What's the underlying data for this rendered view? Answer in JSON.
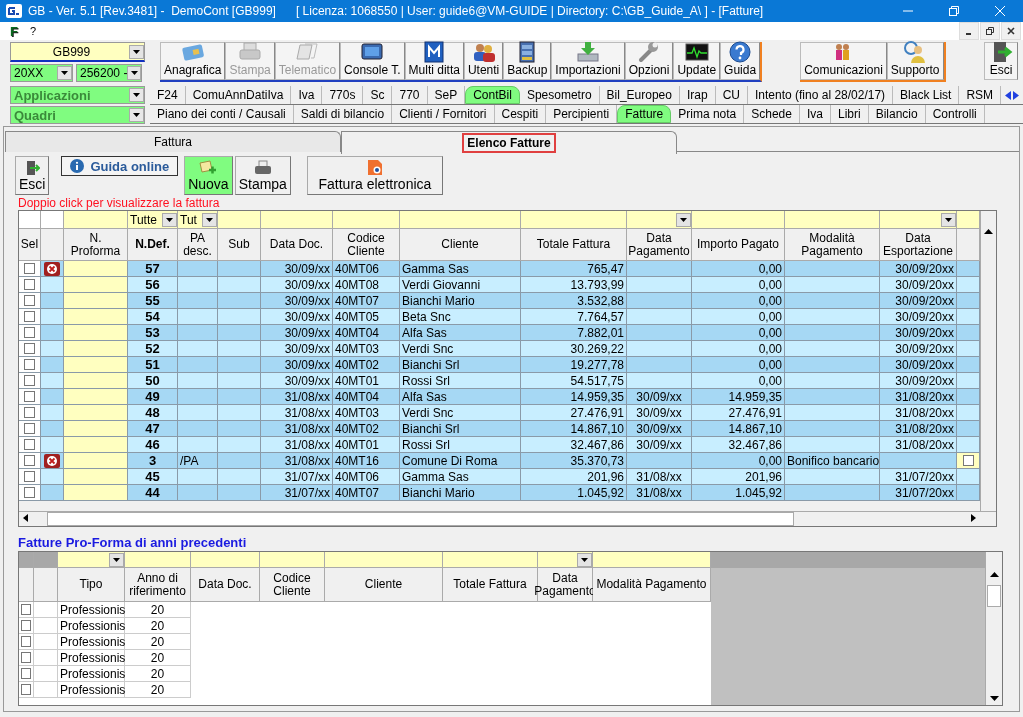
{
  "window": {
    "title": "GB - Ver. 5.1 [Rev.3481] -  DemoCont [GB999]      [ Licenza: 1068550 | User: guide6@VM-GUIDE | Directory: C:\\GB_Guide_A\\ ] - [Fatture]"
  },
  "menu": {
    "logo": "F",
    "items": [
      "?"
    ]
  },
  "selectors": {
    "company": "GB999",
    "year": "20XX",
    "code": "256200 -",
    "applications": "Applicazioni",
    "sections": "Quadri"
  },
  "toolbar": [
    {
      "label": "Anagrafica",
      "disabled": false
    },
    {
      "label": "Stampa",
      "disabled": true
    },
    {
      "label": "Telematico",
      "disabled": true
    },
    {
      "label": "Console T.",
      "disabled": false
    },
    {
      "label": "Multi ditta",
      "disabled": false
    },
    {
      "label": "Utenti",
      "disabled": false
    },
    {
      "label": "Backup",
      "disabled": false
    },
    {
      "label": "Importazioni",
      "disabled": false
    },
    {
      "label": "Opzioni",
      "disabled": false
    },
    {
      "label": "Update",
      "disabled": false
    },
    {
      "label": "Guida",
      "disabled": false
    }
  ],
  "toolbar_support": [
    {
      "label": "Comunicazioni"
    },
    {
      "label": "Supporto"
    }
  ],
  "exit_button": {
    "label": "Esci"
  },
  "app_tabs": [
    {
      "label": "F24",
      "selected": false
    },
    {
      "label": "ComuAnnDatiIva",
      "selected": false
    },
    {
      "label": "Iva",
      "selected": false
    },
    {
      "label": "770s",
      "selected": false
    },
    {
      "label": "Sc",
      "selected": false
    },
    {
      "label": "770",
      "selected": false
    },
    {
      "label": "SeP",
      "selected": false
    },
    {
      "label": "ContBil",
      "selected": true
    },
    {
      "label": "Spesometro",
      "selected": false
    },
    {
      "label": "Bil_Europeo",
      "selected": false
    },
    {
      "label": "Irap",
      "selected": false
    },
    {
      "label": "CU",
      "selected": false
    },
    {
      "label": "Intento (fino al 28/02/17)",
      "selected": false
    },
    {
      "label": "Black List",
      "selected": false
    },
    {
      "label": "RSM",
      "selected": false
    }
  ],
  "section_tabs": [
    {
      "label": "Piano dei conti / Causali",
      "selected": false
    },
    {
      "label": "Saldi di bilancio",
      "selected": false
    },
    {
      "label": "Clienti / Fornitori",
      "selected": false
    },
    {
      "label": "Cespiti",
      "selected": false
    },
    {
      "label": "Percipienti",
      "selected": false
    },
    {
      "label": "Fatture",
      "selected": true
    },
    {
      "label": "Prima nota",
      "selected": false
    },
    {
      "label": "Schede",
      "selected": false
    },
    {
      "label": "Iva",
      "selected": false
    },
    {
      "label": "Libri",
      "selected": false
    },
    {
      "label": "Bilancio",
      "selected": false
    },
    {
      "label": "Controlli",
      "selected": false
    }
  ],
  "page_tabs": [
    {
      "label": "Fattura",
      "selected": false
    },
    {
      "label": "Elenco Fatture",
      "selected": true
    }
  ],
  "actions": [
    {
      "kind": "exit",
      "label": "Esci",
      "highlighted": false
    },
    {
      "kind": "help",
      "label": "Guida online",
      "highlighted": false
    },
    {
      "kind": "new",
      "label": "Nuova",
      "highlighted": true
    },
    {
      "kind": "print",
      "label": "Stampa",
      "highlighted": false
    },
    {
      "kind": "einvoice",
      "label": "Fattura elettronica",
      "highlighted": false
    }
  ],
  "hint": "Doppio click per visualizzare la fattura",
  "table": {
    "columns": [
      {
        "label": "Sel",
        "filter_dropdown": false
      },
      {
        "filter_dropdown": false
      },
      {
        "label": "N. Proforma",
        "filter_dropdown": false
      },
      {
        "label": "N.Def.",
        "filter_value": "Tutte",
        "filter_dropdown": true
      },
      {
        "label": "PA desc.",
        "filter_value": "Tut",
        "filter_dropdown": true
      },
      {
        "label": "Sub",
        "filter_dropdown": false
      },
      {
        "label": "Data Doc.",
        "filter_dropdown": false
      },
      {
        "label": "Codice Cliente",
        "filter_dropdown": false
      },
      {
        "label": "Cliente",
        "filter_dropdown": false
      },
      {
        "label": "Totale Fattura",
        "filter_dropdown": false
      },
      {
        "label": "Data Pagamento",
        "filter_dropdown": true
      },
      {
        "label": "Importo Pagato",
        "filter_dropdown": false
      },
      {
        "label": "Modalità Pagamento",
        "filter_dropdown": false
      },
      {
        "label": "Data Esportazione",
        "filter_dropdown": true
      },
      {
        "filter_dropdown": false
      }
    ],
    "rows": [
      {
        "checked": false,
        "error": true,
        "n_def": "57",
        "data_doc": "30/09/xx",
        "codice": "40MT06",
        "cliente": "Gamma Sas",
        "totale": "765,47",
        "importo": "0,00",
        "data_esp": "30/09/20xx",
        "export_box": false
      },
      {
        "checked": false,
        "error": false,
        "n_def": "56",
        "data_doc": "30/09/xx",
        "codice": "40MT08",
        "cliente": "Verdi Giovanni",
        "totale": "13.793,99",
        "importo": "0,00",
        "data_esp": "30/09/20xx",
        "export_box": false
      },
      {
        "checked": false,
        "error": false,
        "n_def": "55",
        "data_doc": "30/09/xx",
        "codice": "40MT07",
        "cliente": "Bianchi Mario",
        "totale": "3.532,88",
        "importo": "0,00",
        "data_esp": "30/09/20xx",
        "export_box": false
      },
      {
        "checked": false,
        "error": false,
        "n_def": "54",
        "data_doc": "30/09/xx",
        "codice": "40MT05",
        "cliente": "Beta Snc",
        "totale": "7.764,57",
        "importo": "0,00",
        "data_esp": "30/09/20xx",
        "export_box": false
      },
      {
        "checked": false,
        "error": false,
        "n_def": "53",
        "data_doc": "30/09/xx",
        "codice": "40MT04",
        "cliente": "Alfa Sas",
        "totale": "7.882,01",
        "importo": "0,00",
        "data_esp": "30/09/20xx",
        "export_box": false
      },
      {
        "checked": false,
        "error": false,
        "n_def": "52",
        "data_doc": "30/09/xx",
        "codice": "40MT03",
        "cliente": "Verdi Snc",
        "totale": "30.269,22",
        "importo": "0,00",
        "data_esp": "30/09/20xx",
        "export_box": false
      },
      {
        "checked": false,
        "error": false,
        "n_def": "51",
        "data_doc": "30/09/xx",
        "codice": "40MT02",
        "cliente": "Bianchi Srl",
        "totale": "19.277,78",
        "importo": "0,00",
        "data_esp": "30/09/20xx",
        "export_box": false
      },
      {
        "checked": false,
        "error": false,
        "n_def": "50",
        "data_doc": "30/09/xx",
        "codice": "40MT01",
        "cliente": "Rossi Srl",
        "totale": "54.517,75",
        "importo": "0,00",
        "data_esp": "30/09/20xx",
        "export_box": false
      },
      {
        "checked": false,
        "error": false,
        "n_def": "49",
        "data_doc": "31/08/xx",
        "codice": "40MT04",
        "cliente": "Alfa Sas",
        "totale": "14.959,35",
        "data_pag": "30/09/xx",
        "importo": "14.959,35",
        "data_esp": "31/08/20xx",
        "export_box": false
      },
      {
        "checked": false,
        "error": false,
        "n_def": "48",
        "data_doc": "31/08/xx",
        "codice": "40MT03",
        "cliente": "Verdi Snc",
        "totale": "27.476,91",
        "data_pag": "30/09/xx",
        "importo": "27.476,91",
        "data_esp": "31/08/20xx",
        "export_box": false
      },
      {
        "checked": false,
        "error": false,
        "n_def": "47",
        "data_doc": "31/08/xx",
        "codice": "40MT02",
        "cliente": "Bianchi Srl",
        "totale": "14.867,10",
        "data_pag": "30/09/xx",
        "importo": "14.867,10",
        "data_esp": "31/08/20xx",
        "export_box": false
      },
      {
        "checked": false,
        "error": false,
        "n_def": "46",
        "data_doc": "31/08/xx",
        "codice": "40MT01",
        "cliente": "Rossi Srl",
        "totale": "32.467,86",
        "data_pag": "30/09/xx",
        "importo": "32.467,86",
        "data_esp": "31/08/20xx",
        "export_box": false
      },
      {
        "checked": false,
        "error": true,
        "n_def": "3",
        "pa_desc": "/PA",
        "data_doc": "31/08/xx",
        "codice": "40MT16",
        "cliente": "Comune Di Roma",
        "totale": "35.370,73",
        "importo": "0,00",
        "modalita": "Bonifico bancario",
        "export_box": true
      },
      {
        "checked": false,
        "error": false,
        "n_def": "45",
        "data_doc": "31/07/xx",
        "codice": "40MT06",
        "cliente": "Gamma Sas",
        "totale": "201,96",
        "data_pag": "31/08/xx",
        "importo": "201,96",
        "data_esp": "31/07/20xx",
        "export_box": false
      },
      {
        "checked": false,
        "error": false,
        "n_def": "44",
        "data_doc": "31/07/xx",
        "codice": "40MT07",
        "cliente": "Bianchi Mario",
        "totale": "1.045,92",
        "data_pag": "31/08/xx",
        "importo": "1.045,92",
        "data_esp": "31/07/20xx",
        "export_box": false
      }
    ]
  },
  "proforma": {
    "title": "Fatture Pro-Forma di anni precedenti",
    "columns": [
      {
        "filter_dropdown": false
      },
      {
        "filter_dropdown": false
      },
      {
        "label": "Tipo",
        "filter_dropdown": true
      },
      {
        "label": "Anno di riferimento",
        "filter_dropdown": false
      },
      {
        "label": "Data Doc.",
        "filter_dropdown": false
      },
      {
        "label": "Codice Cliente",
        "filter_dropdown": false
      },
      {
        "label": "Cliente",
        "filter_dropdown": false
      },
      {
        "label": "Totale Fattura",
        "filter_dropdown": false
      },
      {
        "label": "Data Pagamento",
        "filter_dropdown": true
      },
      {
        "label": "Modalità Pagamento",
        "filter_dropdown": false
      }
    ],
    "rows": [
      {
        "checked": false,
        "tipo": "Professionis",
        "anno": "20"
      },
      {
        "checked": false,
        "tipo": "Professionis",
        "anno": "20"
      },
      {
        "checked": false,
        "tipo": "Professionis",
        "anno": "20"
      },
      {
        "checked": false,
        "tipo": "Professionis",
        "anno": "20"
      },
      {
        "checked": false,
        "tipo": "Professionis",
        "anno": "20"
      },
      {
        "checked": false,
        "tipo": "Professionis",
        "anno": "20"
      }
    ]
  }
}
